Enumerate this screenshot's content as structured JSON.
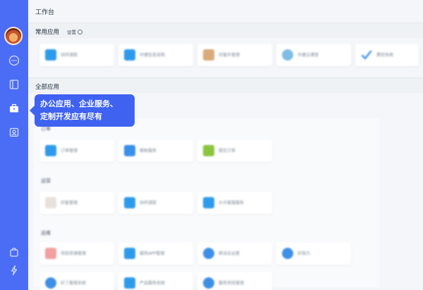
{
  "page_title": "工作台",
  "common_apps": {
    "label": "常用应用",
    "settings_label": "设置",
    "items": [
      {
        "label": "协同请款",
        "icon": "app-icon-blue"
      },
      {
        "label": "中建信息采购",
        "icon": "app-icon-blue"
      },
      {
        "label": "印鉴外管理",
        "icon": "app-icon-tan"
      },
      {
        "label": "中建云课堂",
        "icon": "app-icon-teal"
      },
      {
        "label": "费控系统",
        "icon": "app-icon-check"
      }
    ]
  },
  "all_apps": {
    "label": "全部应用",
    "groups": [
      {
        "label": "订单",
        "items": [
          {
            "label": "订单管理",
            "icon": "app-icon-blue"
          },
          {
            "label": "报账服务",
            "icon": "app-icon-blue"
          },
          {
            "label": "提交订单",
            "icon": "app-icon-green"
          }
        ]
      },
      {
        "label": "运营",
        "items": [
          {
            "label": "印鉴管理",
            "icon": "app-icon-grey"
          },
          {
            "label": "协同请款",
            "icon": "app-icon-blue"
          },
          {
            "label": "大众客服服务",
            "icon": "app-icon-blue"
          }
        ]
      },
      {
        "label": "运维",
        "items": [
          {
            "label": "项目资源管理",
            "icon": "app-icon-pink"
          },
          {
            "label": "服务APP管理",
            "icon": "app-icon-blue"
          },
          {
            "label": "移动云运营",
            "icon": "app-icon-round"
          },
          {
            "label": "好指力",
            "icon": "app-icon-round"
          }
        ]
      },
      {
        "label": "",
        "items": [
          {
            "label": "好了看报系统",
            "icon": "app-icon-round"
          },
          {
            "label": "产品服务系统",
            "icon": "app-icon-blue"
          },
          {
            "label": "服务项目管理",
            "icon": "app-icon-round"
          }
        ]
      }
    ]
  },
  "tooltip": {
    "line1": "办公应用、企业服务、",
    "line2": "定制开发应有尽有"
  },
  "sidebar": {
    "icons": [
      "chat-icon",
      "book-icon",
      "briefcase-icon",
      "contact-card-icon",
      "bag-icon",
      "lightning-icon"
    ]
  },
  "colors": {
    "sidebar": "#4b6cf5",
    "tooltip": "#3f62f0",
    "background": "#f4f6f9"
  }
}
